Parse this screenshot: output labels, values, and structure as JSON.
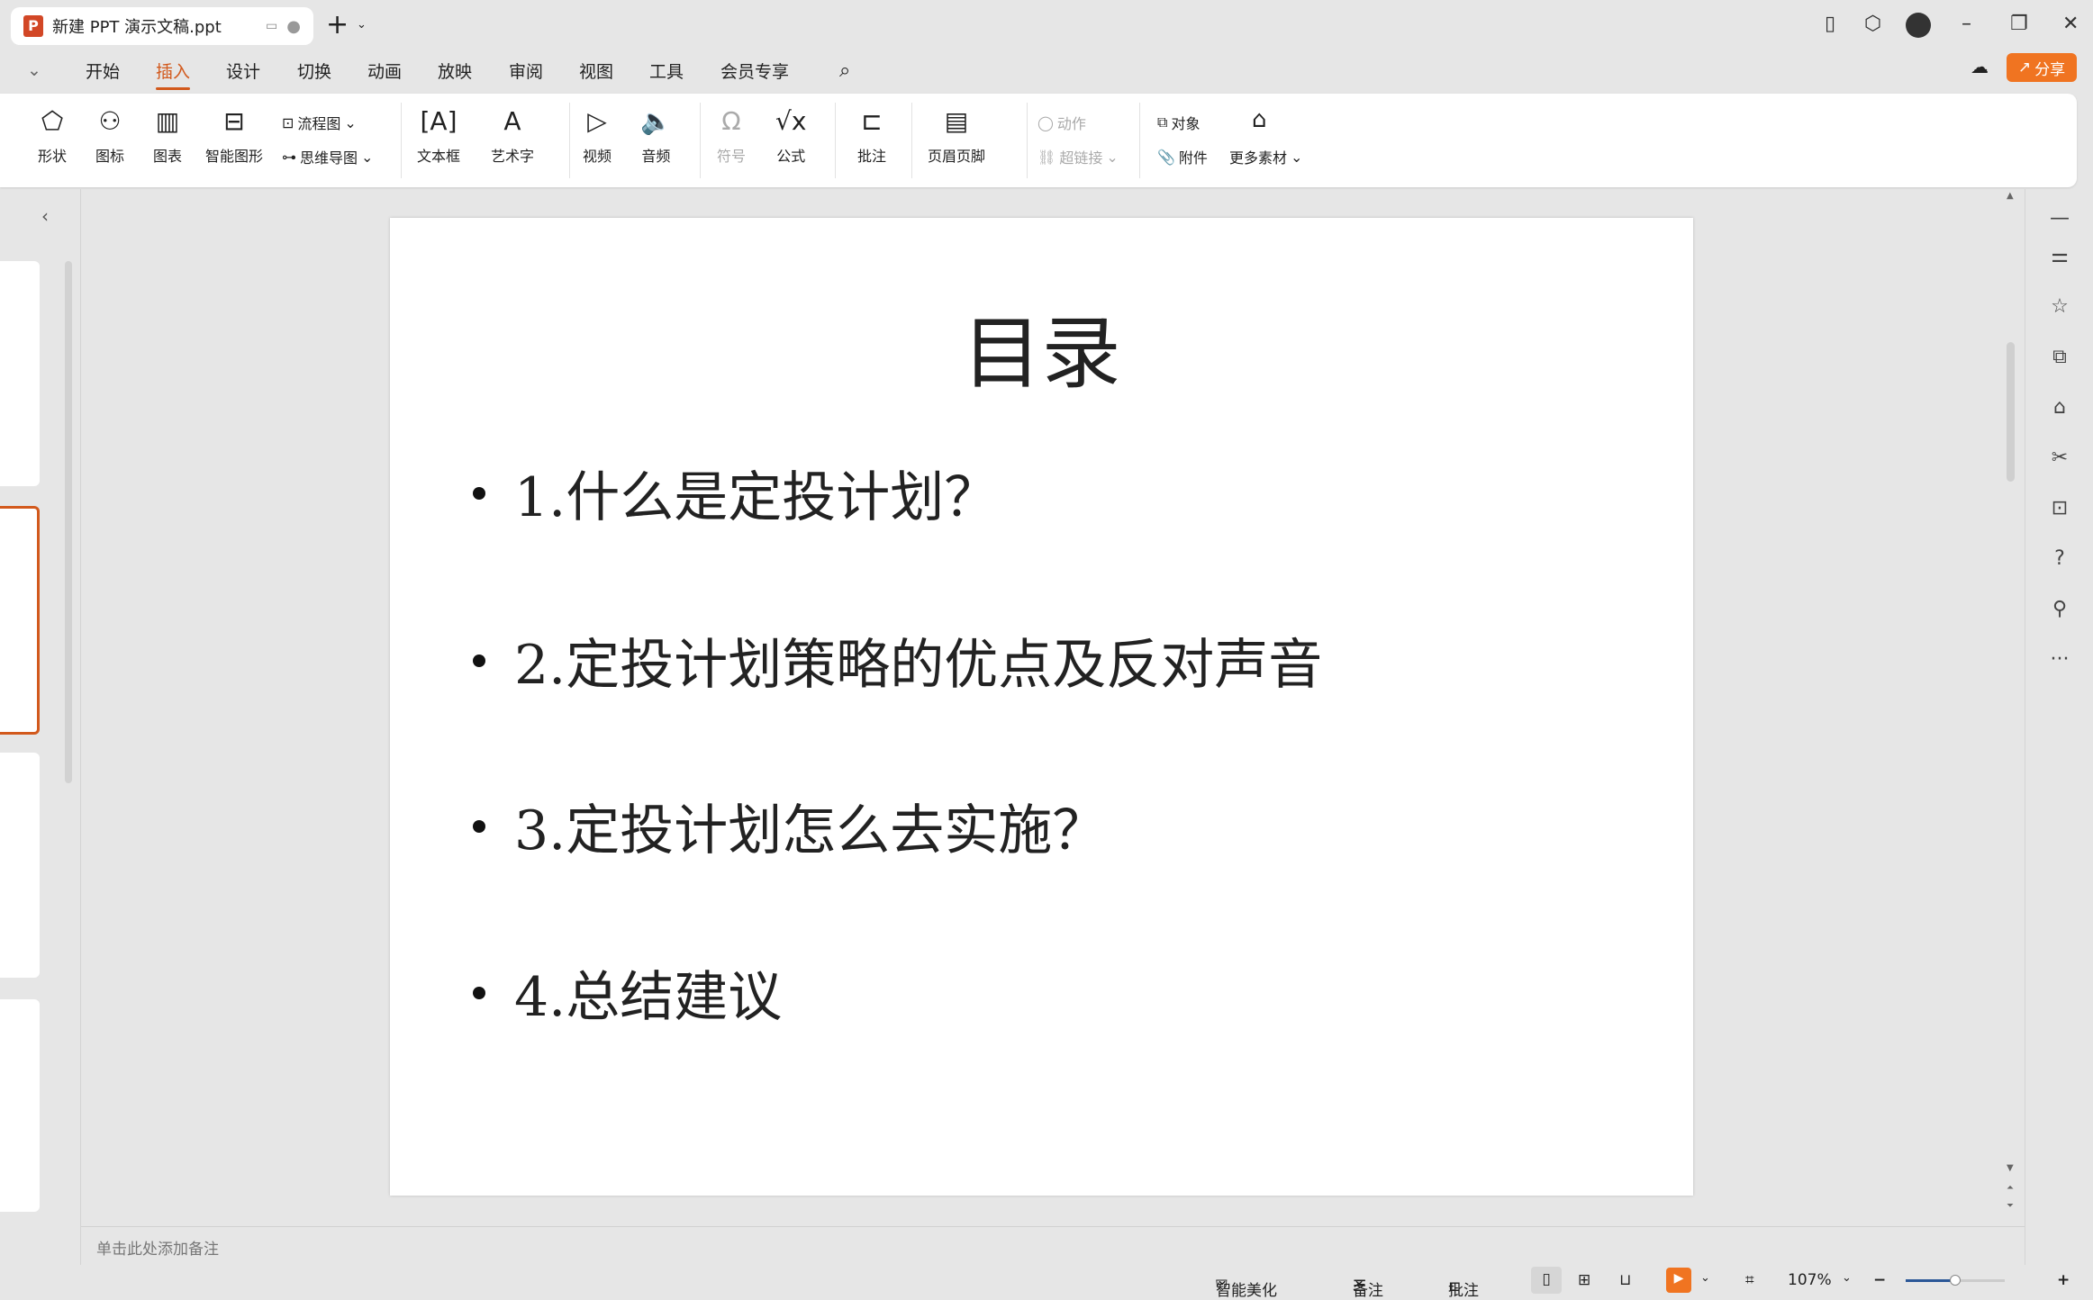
{
  "window": {
    "tab_title": "新建 PPT 演示文稿.ppt",
    "app_icon": "P",
    "new_tab": "+"
  },
  "menu": {
    "items": [
      "开始",
      "插入",
      "设计",
      "切换",
      "动画",
      "放映",
      "审阅",
      "视图",
      "工具",
      "会员专享"
    ],
    "active": "插入",
    "share": "分享"
  },
  "ribbon": {
    "shape": "形状",
    "icon": "图标",
    "chart": "图表",
    "smartart": "智能图形",
    "flowchart": "流程图",
    "mindmap": "思维导图",
    "textbox": "文本框",
    "wordart": "艺术字",
    "video": "视频",
    "audio": "音频",
    "symbol": "符号",
    "formula": "公式",
    "comment": "批注",
    "headerfooter": "页眉页脚",
    "action": "动作",
    "hyperlink": "超链接",
    "object": "对象",
    "attachment": "附件",
    "more": "更多素材"
  },
  "slide": {
    "title": "目录",
    "bullets": [
      "1.什么是定投计划？",
      "2.定投计划策略的优点及反对声音",
      "3.定投计划怎么去实施？",
      "4.总结建议"
    ]
  },
  "notes": {
    "placeholder": "单击此处添加备注"
  },
  "status": {
    "beautify": "智能美化",
    "notes": "备注",
    "comment": "批注",
    "zoom": "107%",
    "zoom_fraction": 0.5
  },
  "colors": {
    "accent": "#d2591c",
    "share": "#f07421"
  }
}
